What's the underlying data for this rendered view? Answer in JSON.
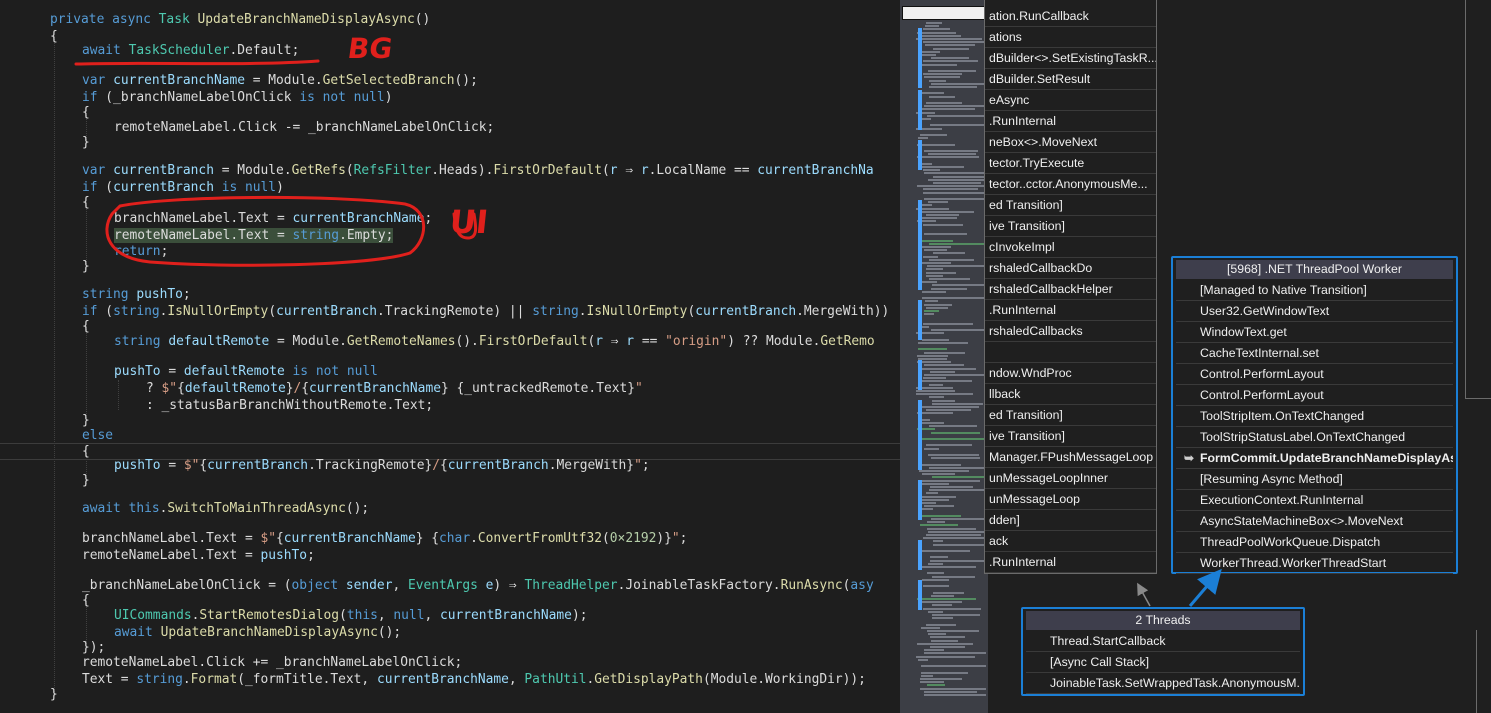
{
  "editor": {
    "annotations": {
      "bg": "BG",
      "ui": "UI"
    }
  },
  "minimap": {},
  "stacks": {
    "left_panel": {
      "frames": [
        "ation.RunCallback",
        "ations",
        "dBuilder<>.SetExistingTaskR...",
        "dBuilder.SetResult",
        "eAsync",
        ".RunInternal",
        "neBox<>.MoveNext",
        "tector.TryExecute",
        "tector..cctor.AnonymousMe...",
        "ed Transition]",
        "ive Transition]",
        "cInvokeImpl",
        "rshaledCallbackDo",
        "rshaledCallbackHelper",
        ".RunInternal",
        "rshaledCallbacks",
        "",
        "ndow.WndProc",
        "llback",
        "ed Transition]",
        "ive Transition]",
        "Manager.FPushMessageLoop",
        "unMessageLoopInner",
        "unMessageLoop",
        "dden]",
        "ack",
        ".RunInternal"
      ]
    },
    "worker_panel": {
      "header": "[5968] .NET ThreadPool Worker",
      "frames": [
        "[Managed to Native Transition]",
        "User32.GetWindowText",
        "WindowText.get",
        "CacheTextInternal.set",
        "Control.PerformLayout",
        "Control.PerformLayout",
        "ToolStripItem.OnTextChanged",
        "ToolStripStatusLabel.OnTextChanged",
        "FormCommit.UpdateBranchNameDisplayAsync",
        "[Resuming Async Method]",
        "ExecutionContext.RunInternal",
        "AsyncStateMachineBox<>.MoveNext",
        "ThreadPoolWorkQueue.Dispatch",
        "WorkerThread.WorkerThreadStart"
      ],
      "current_frame_index": 8
    },
    "threads_panel": {
      "header": "2 Threads",
      "frames": [
        "Thread.StartCallback",
        "[Async Call Stack]",
        "JoinableTask.SetWrappedTask.AnonymousM..."
      ]
    }
  }
}
